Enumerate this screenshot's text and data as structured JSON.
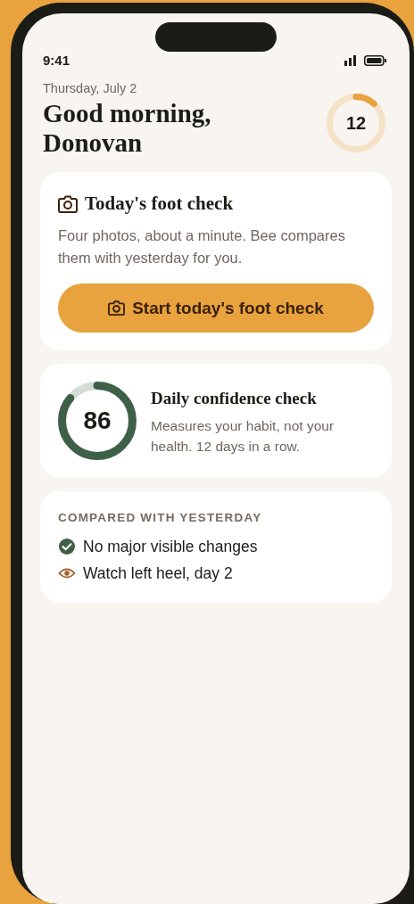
{
  "status_bar": {
    "time": "9:41"
  },
  "header": {
    "date": "Thursday, July 2",
    "greeting": "Good morning,\nDonovan",
    "streak": {
      "value": "12",
      "level": 0.12
    }
  },
  "foot_check_card": {
    "title": "Today's foot check",
    "description": "Four photos, about a minute. Bee compares them with yesterday for you.",
    "button": "Start today's foot check"
  },
  "confidence_card": {
    "score": "86",
    "level": 0.86,
    "title": "Daily confidence check",
    "description": "Measures your habit, not your health. 12 days in a row."
  },
  "comparison_card": {
    "heading": "COMPARED WITH YESTERDAY",
    "items": [
      {
        "kind": "ok",
        "text": "No major visible changes"
      },
      {
        "kind": "watch",
        "text": "Watch left heel, day 2"
      }
    ]
  }
}
